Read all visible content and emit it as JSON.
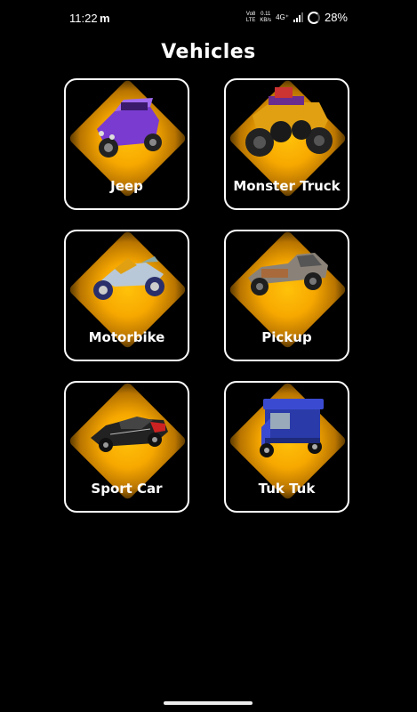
{
  "status_bar": {
    "time": "11:22",
    "carrier_icon": "m",
    "volte_top": "Vo8",
    "volte_bottom": "LTE",
    "speed_top": "0.11",
    "speed_bottom": "KB/s",
    "network": "4G⁺",
    "battery": "28%"
  },
  "title": "Vehicles",
  "vehicles": [
    {
      "label": "Jeep",
      "icon": "jeep-image"
    },
    {
      "label": "Monster Truck",
      "icon": "monster-truck-image"
    },
    {
      "label": "Motorbike",
      "icon": "motorbike-image"
    },
    {
      "label": "Pickup",
      "icon": "pickup-image"
    },
    {
      "label": "Sport Car",
      "icon": "sport-car-image"
    },
    {
      "label": "Tuk Tuk",
      "icon": "tuk-tuk-image"
    }
  ]
}
